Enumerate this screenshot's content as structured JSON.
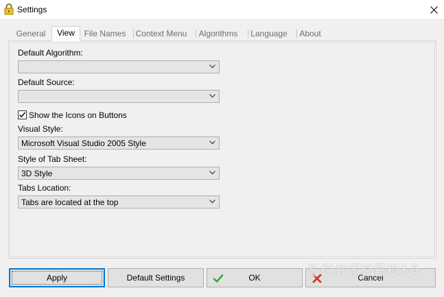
{
  "window": {
    "title": "Settings",
    "icon": "lock-icon"
  },
  "tabs": [
    {
      "label": "General",
      "active": false
    },
    {
      "label": "View",
      "active": true
    },
    {
      "label": "File Names",
      "active": false
    },
    {
      "label": "Context Menu",
      "active": false
    },
    {
      "label": "Algorithms",
      "active": false
    },
    {
      "label": "Language",
      "active": false
    },
    {
      "label": "About",
      "active": false
    }
  ],
  "view": {
    "default_algorithm": {
      "label": "Default Algorithm:",
      "value": ""
    },
    "default_source": {
      "label": "Default Source:",
      "value": ""
    },
    "show_icons": {
      "label": "Show the Icons on Buttons",
      "checked": true
    },
    "visual_style": {
      "label": "Visual Style:",
      "value": "Microsoft Visual Studio 2005 Style"
    },
    "tab_sheet_style": {
      "label": "Style of Tab Sheet:",
      "value": "3D Style"
    },
    "tabs_location": {
      "label": "Tabs Location:",
      "value": "Tabs are located at the top"
    }
  },
  "buttons": {
    "apply": "Apply",
    "default_settings": "Default Settings",
    "ok": "OK",
    "cancel": "Cancel"
  },
  "watermark": "SOFTPEDIA",
  "colors": {
    "focus_border": "#0078d7",
    "ok_check": "#3aa935",
    "cancel_x": "#d9342b"
  }
}
